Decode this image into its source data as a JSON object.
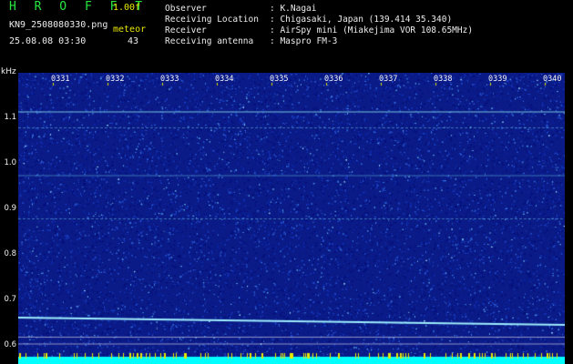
{
  "header": {
    "app_title": "H R O F F T",
    "version": "1.00f",
    "filename": "KN9_2508080330.png",
    "datetime": "25.08.08 03:30",
    "count_label": "meteor",
    "count_value": "43"
  },
  "info": {
    "observer_label": "Observer",
    "observer_value": ": K.Nagai",
    "location_label": "Receiving Location",
    "location_value": ": Chigasaki, Japan (139.414 35.340)",
    "receiver_label": "Receiver",
    "receiver_value": ": AirSpy mini (Miakejima VOR 108.65MHz)",
    "antenna_label": "Receiving antenna",
    "antenna_value": ": Maspro FM-3"
  },
  "axis": {
    "unit": "kHz",
    "y_ticks": [
      {
        "label": "1.1",
        "value": 1.1
      },
      {
        "label": "1.0",
        "value": 1.0
      },
      {
        "label": "0.9",
        "value": 0.9
      },
      {
        "label": "0.8",
        "value": 0.8
      },
      {
        "label": "0.7",
        "value": 0.7
      },
      {
        "label": "0.6",
        "value": 0.6
      }
    ],
    "y_range": [
      0.56,
      1.2
    ],
    "x_ticks": [
      "0331",
      "0332",
      "0333",
      "0334",
      "0335",
      "0336",
      "0337",
      "0338",
      "0339",
      "0340"
    ]
  },
  "colors": {
    "background": "#000000",
    "plot_noise": "#0b1a8c",
    "title_green": "#27e640",
    "label_yellow": "#e8e800",
    "trace": "#9ff0ff",
    "baseline": "#00ffff"
  },
  "spectrogram": {
    "horizontal_carriers_khz": [
      1.115,
      1.08,
      0.975,
      0.88,
      0.62,
      0.605
    ],
    "meteor_trace": {
      "start_khz": 0.662,
      "end_khz": 0.646
    }
  }
}
